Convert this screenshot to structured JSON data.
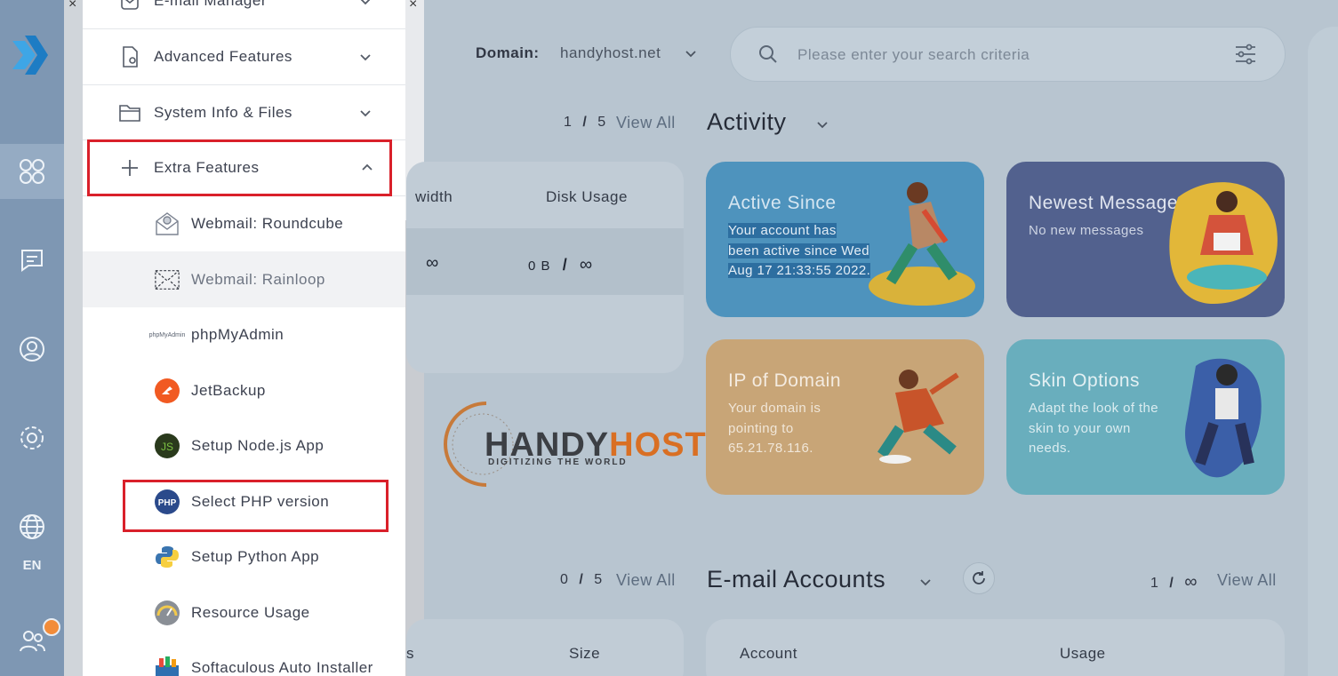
{
  "rail": {
    "items": [
      {
        "name": "dashboard",
        "icon": "grid-icon",
        "active": true
      },
      {
        "name": "messages",
        "icon": "message-icon",
        "active": false
      },
      {
        "name": "account",
        "icon": "user-circle-icon",
        "active": false
      },
      {
        "name": "settings",
        "icon": "gear-icon",
        "active": false
      },
      {
        "name": "language",
        "icon": "globe-icon",
        "active": false
      }
    ],
    "language": "EN",
    "accent": "#f28c3a"
  },
  "menu": {
    "sections": [
      {
        "label": "E-mail Manager",
        "icon": "mail-manager-icon",
        "expanded": false
      },
      {
        "label": "Advanced Features",
        "icon": "advanced-file-icon",
        "expanded": false
      },
      {
        "label": "System Info & Files",
        "icon": "folder-icon",
        "expanded": false
      },
      {
        "label": "Extra Features",
        "icon": "plus-icon",
        "expanded": true
      }
    ],
    "extra_items": [
      {
        "label": "Webmail: Roundcube",
        "icon": "roundcube-icon"
      },
      {
        "label": "Webmail: Rainloop",
        "icon": "rainloop-icon"
      },
      {
        "label": "phpMyAdmin",
        "icon": "phpmyadmin-icon",
        "icon_text": "phpMyAdmin"
      },
      {
        "label": "JetBackup",
        "icon": "jetbackup-icon"
      },
      {
        "label": "Setup Node.js App",
        "icon": "nodejs-icon",
        "icon_text": "JS"
      },
      {
        "label": "Select PHP version",
        "icon": "php-icon",
        "icon_text": "PHP"
      },
      {
        "label": "Setup Python App",
        "icon": "python-icon"
      },
      {
        "label": "Resource Usage",
        "icon": "gauge-icon"
      },
      {
        "label": "Softaculous Auto Installer",
        "icon": "softaculous-icon"
      }
    ],
    "highlight_color": "#d9202a"
  },
  "header": {
    "domain_label": "Domain:",
    "domain_value": "handyhost.net",
    "search_placeholder": "Please enter your search criteria"
  },
  "usage": {
    "counter_a": "1",
    "counter_sep": "/",
    "counter_b": "5",
    "view_all": "View All",
    "col_bandwidth": "width",
    "col_disk": "Disk Usage",
    "bandwidth_value": "∞",
    "disk_used": "0 B",
    "disk_sep": "/",
    "disk_limit": "∞"
  },
  "brand": {
    "name_a": "HANDY",
    "name_b": "HOST",
    "tagline": "DIGITIZING THE WORLD"
  },
  "activity": {
    "title": "Activity",
    "tiles": [
      {
        "title": "Active Since",
        "body_lines": [
          "Your account has",
          "been active since Wed",
          "Aug 17 21:33:55 2022."
        ]
      },
      {
        "title": "Newest Message",
        "body": "No new messages"
      },
      {
        "title": "IP of Domain",
        "body_lines": [
          "Your domain is",
          "pointing to",
          "65.21.78.116."
        ]
      },
      {
        "title": "Skin Options",
        "body_lines": [
          "Adapt the look of the",
          "skin to your own",
          "needs."
        ]
      }
    ]
  },
  "databases": {
    "counter_a": "0",
    "counter_sep": "/",
    "counter_b": "5",
    "view_all": "View All",
    "col_a": "s",
    "col_b": "Size"
  },
  "email_accounts": {
    "title": "E-mail Accounts",
    "counter_a": "1",
    "counter_sep": "/",
    "counter_b": "∞",
    "view_all": "View All",
    "col_account": "Account",
    "col_usage": "Usage"
  }
}
